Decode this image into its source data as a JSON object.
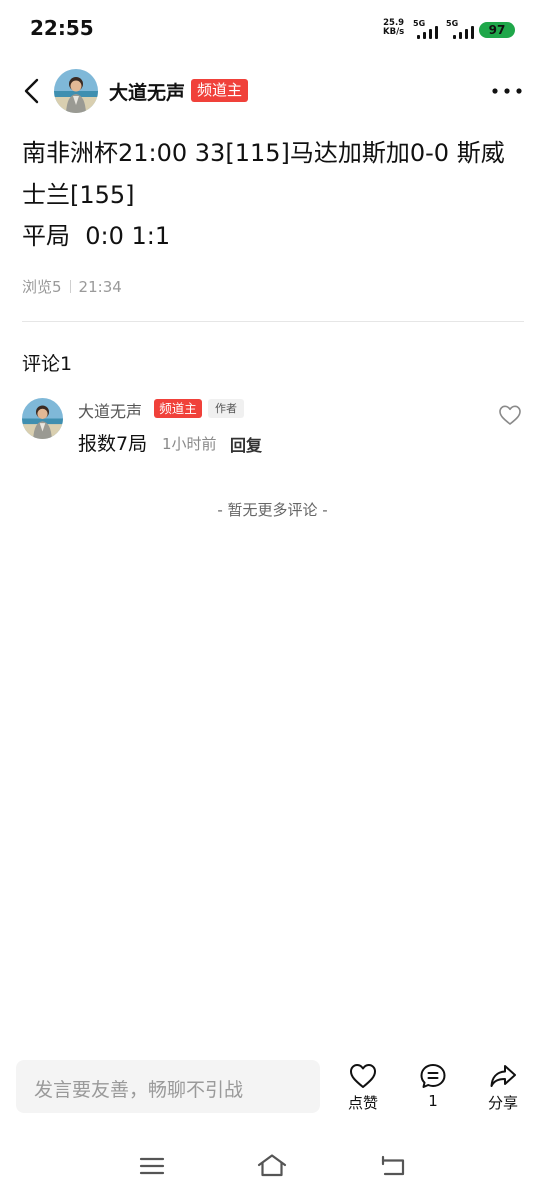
{
  "status_bar": {
    "time": "22:55",
    "net_speed_value": "25.9",
    "net_speed_unit": "KB/s",
    "sim1_label": "5G",
    "sim2_label": "5G",
    "battery": "97",
    "battery_color": "#1fa74a"
  },
  "header": {
    "back_icon": "chevron-left-icon",
    "author_name": "大道无声",
    "author_badge": "频道主",
    "more_icon": "more-dots-icon"
  },
  "post": {
    "title": "南非洲杯21:00 33[115]马达加斯加0-0 斯威士兰[155]",
    "result": "平局  0:0 1:1",
    "views": "浏览5",
    "time": "21:34"
  },
  "comments": {
    "heading": "评论1",
    "items": [
      {
        "name": "大道无声",
        "badge": "频道主",
        "author_tag": "作者",
        "text": "报数7局",
        "time": "1小时前",
        "reply": "回复"
      }
    ],
    "no_more": "- 暂无更多评论 -"
  },
  "bottom_bar": {
    "input_placeholder": "发言要友善，畅聊不引战",
    "like_label": "点赞",
    "comment_count": "1",
    "share_label": "分享"
  },
  "colors": {
    "badge_red": "#f0413a",
    "muted_text": "#9a9a9a"
  }
}
